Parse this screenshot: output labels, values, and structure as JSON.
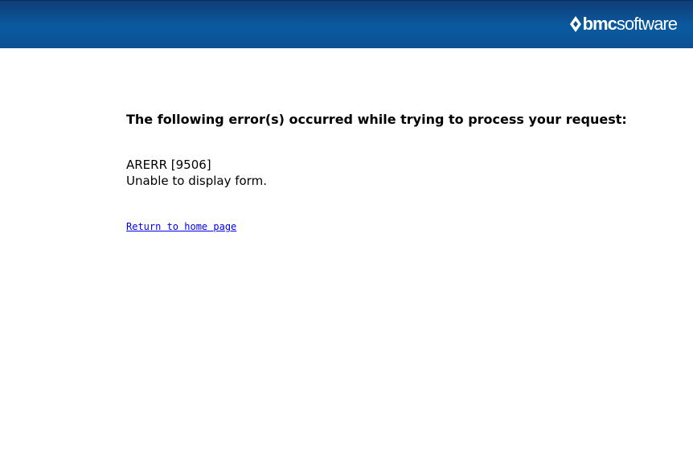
{
  "header": {
    "logo_bmc": "bmc",
    "logo_software": "software",
    "logo_icon": "bmc-diamond-logo-icon"
  },
  "main": {
    "heading": "The following error(s) occurred while trying to process your request:",
    "error_code": "ARERR [9506]",
    "error_message": "Unable to display form.",
    "home_link": "Return to home page"
  },
  "colors": {
    "header_blue": "#0a5aa0",
    "link": "#0000ee"
  }
}
